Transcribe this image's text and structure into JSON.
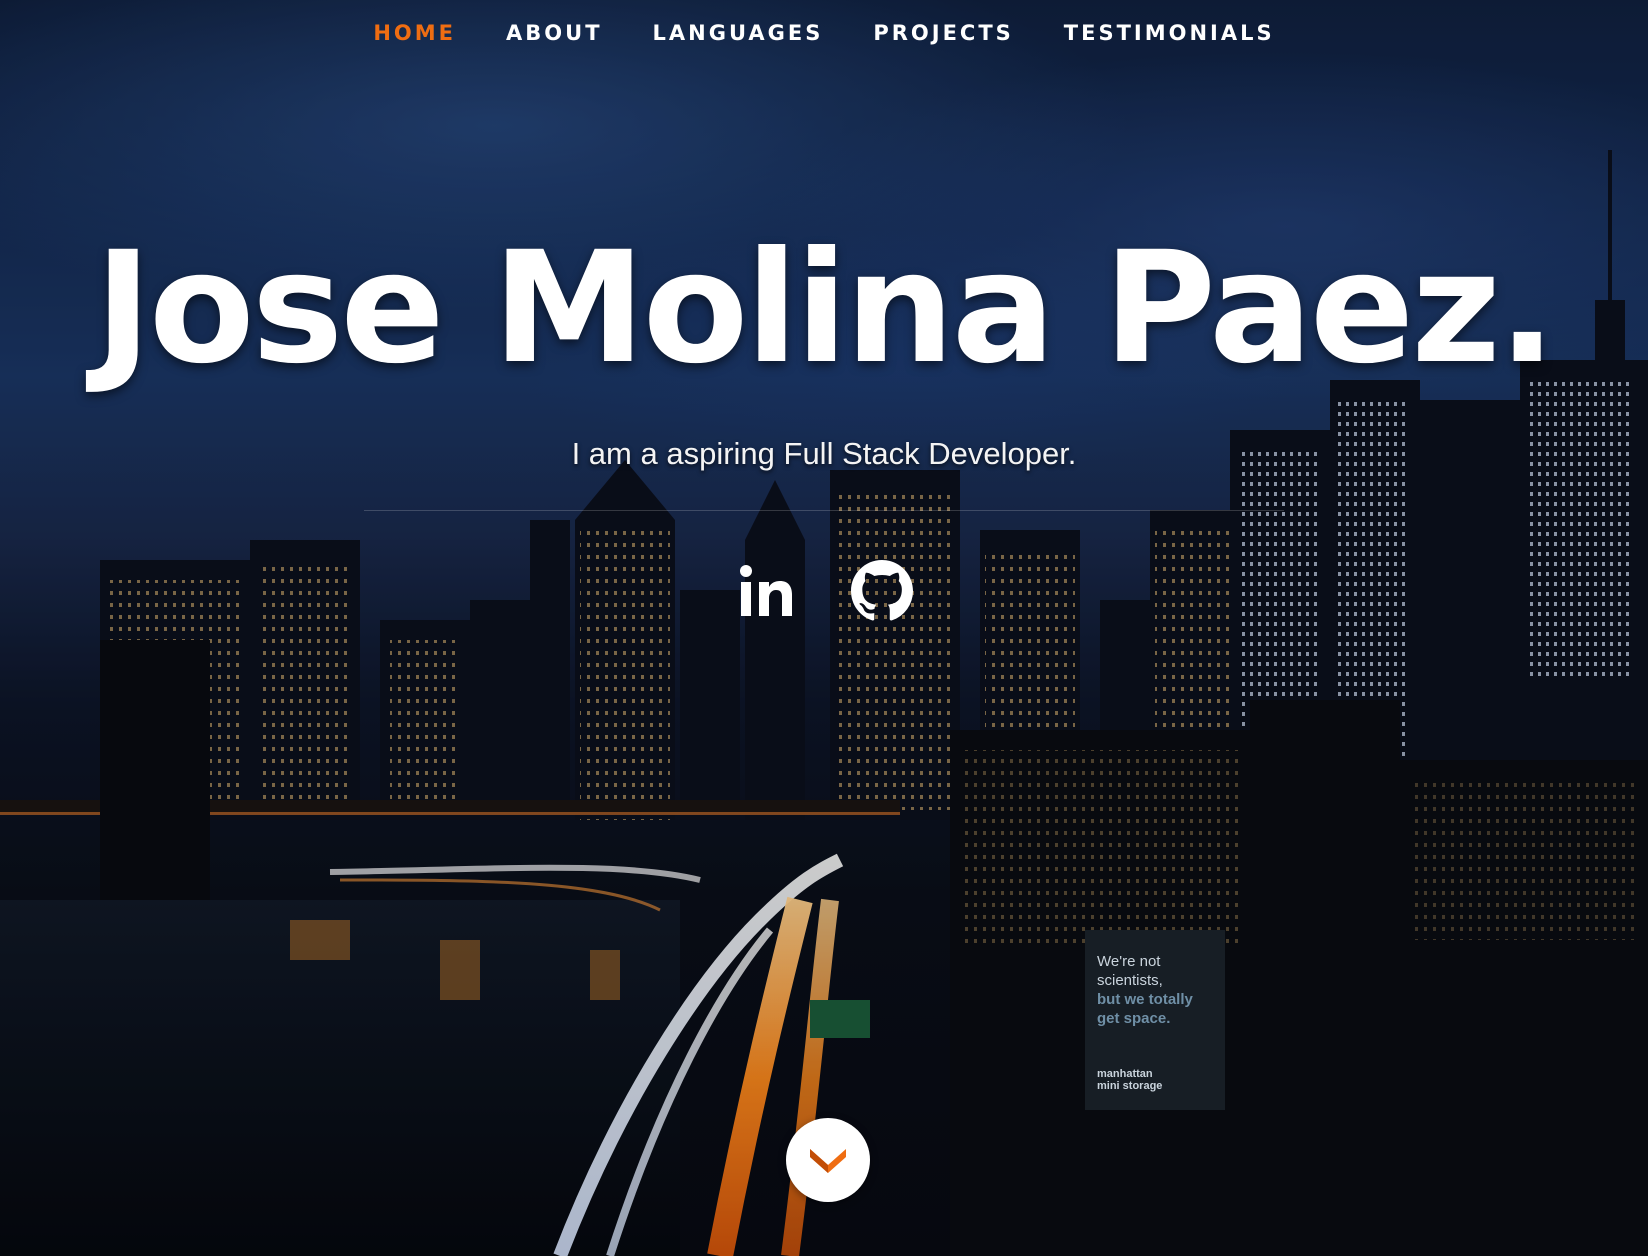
{
  "nav": {
    "items": [
      {
        "label": "HOME",
        "active": true
      },
      {
        "label": "ABOUT",
        "active": false
      },
      {
        "label": "LANGUAGES",
        "active": false
      },
      {
        "label": "PROJECTS",
        "active": false
      },
      {
        "label": "TESTIMONIALS",
        "active": false
      }
    ],
    "active_color": "#ef6d12"
  },
  "banner": {
    "title": "Jose Molina Paez.",
    "subtitle": "I am a aspiring Full Stack Developer."
  },
  "social": {
    "icons": [
      "linkedin-icon",
      "github-icon"
    ]
  },
  "scroll": {
    "icon": "chevron-down-icon"
  },
  "billboard": {
    "line1": "We're not",
    "line2": "scientists,",
    "line3": "but we totally",
    "line4": "get space.",
    "brand1": "manhattan",
    "brand2": "mini storage"
  },
  "colors": {
    "accent": "#ef6d12",
    "text": "#ffffff"
  }
}
